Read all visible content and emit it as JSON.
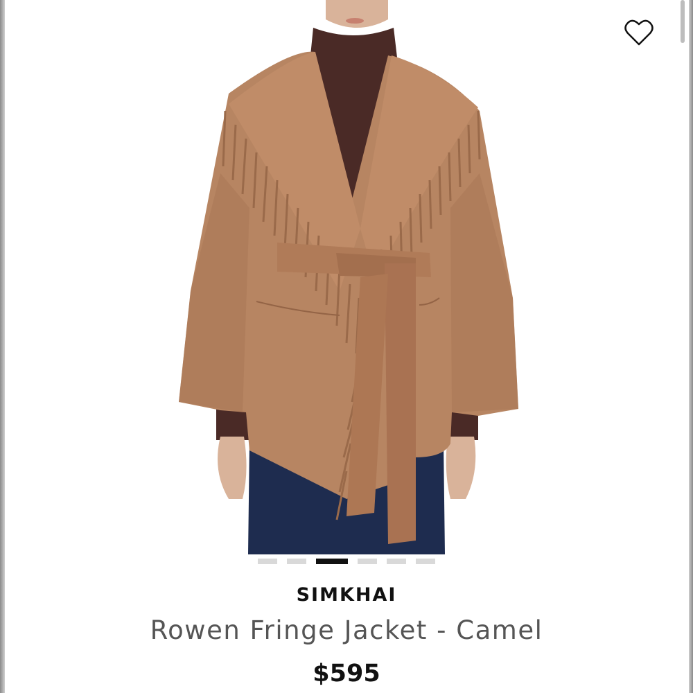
{
  "product": {
    "brand": "SIMKHAI",
    "name": "Rowen Fringe Jacket - Camel",
    "price": "$595"
  },
  "gallery": {
    "total_images": 6,
    "active_index": 2
  },
  "icons": {
    "favorite": "heart-outline-icon"
  },
  "colors": {
    "coat": "#b78562",
    "turtleneck": "#4a2a26",
    "jeans": "#1e2c4f",
    "active_dot": "#111111",
    "inactive_dot": "#d9d9d9"
  }
}
